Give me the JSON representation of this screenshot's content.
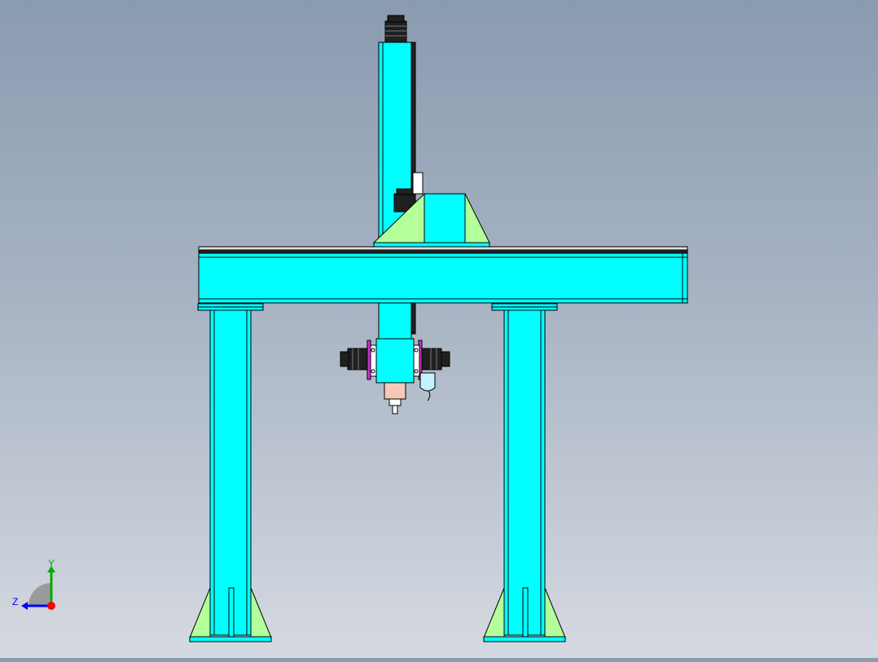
{
  "colors": {
    "frame": "#00ffff",
    "gusset": "#b3ff99",
    "motor": "#202020",
    "flange": "#cc33cc",
    "spindle": "#f5c8b8",
    "outline": "#000000",
    "axis_y": "#00aa00",
    "axis_z": "#0000ff",
    "axis_origin": "#ff0000"
  },
  "triad": {
    "y_label": "Y",
    "z_label": "Z"
  }
}
